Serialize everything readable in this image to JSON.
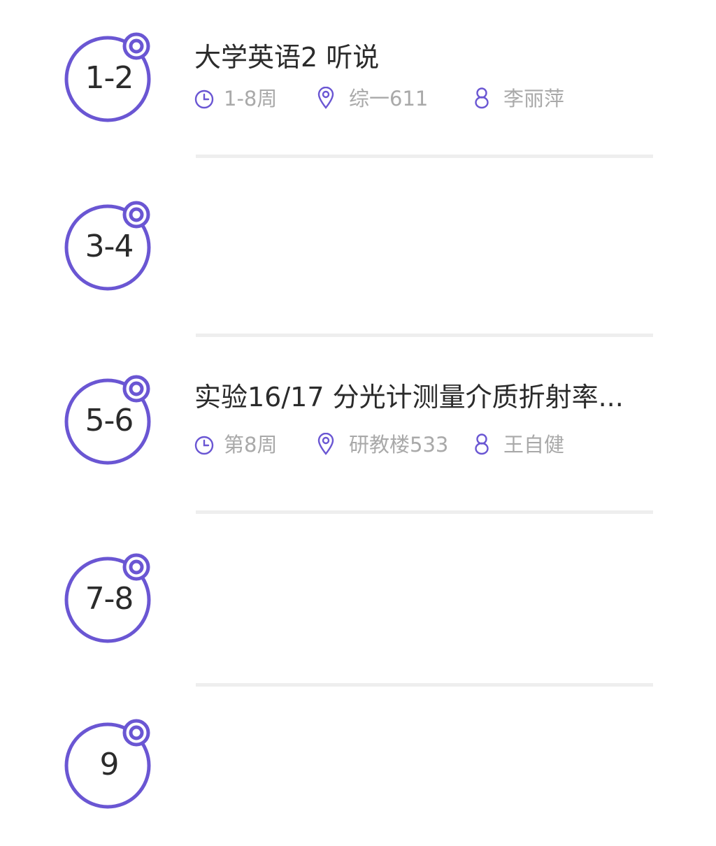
{
  "accent_color": "#6a56d3",
  "slots": [
    {
      "period": "1-2",
      "course": {
        "title": "大学英语2  听说",
        "weeks": "1-8周",
        "room": "综一611",
        "teacher": "李丽萍"
      }
    },
    {
      "period": "3-4"
    },
    {
      "period": "5-6",
      "course": {
        "title": "实验16/17  分光计测量介质折射率...",
        "weeks": "第8周",
        "room": "研教楼533",
        "teacher": "王自健"
      }
    },
    {
      "period": "7-8"
    },
    {
      "period": "9"
    }
  ],
  "icons": {
    "weeks": "clock-icon",
    "room": "location-pin-icon",
    "teacher": "person-icon"
  }
}
